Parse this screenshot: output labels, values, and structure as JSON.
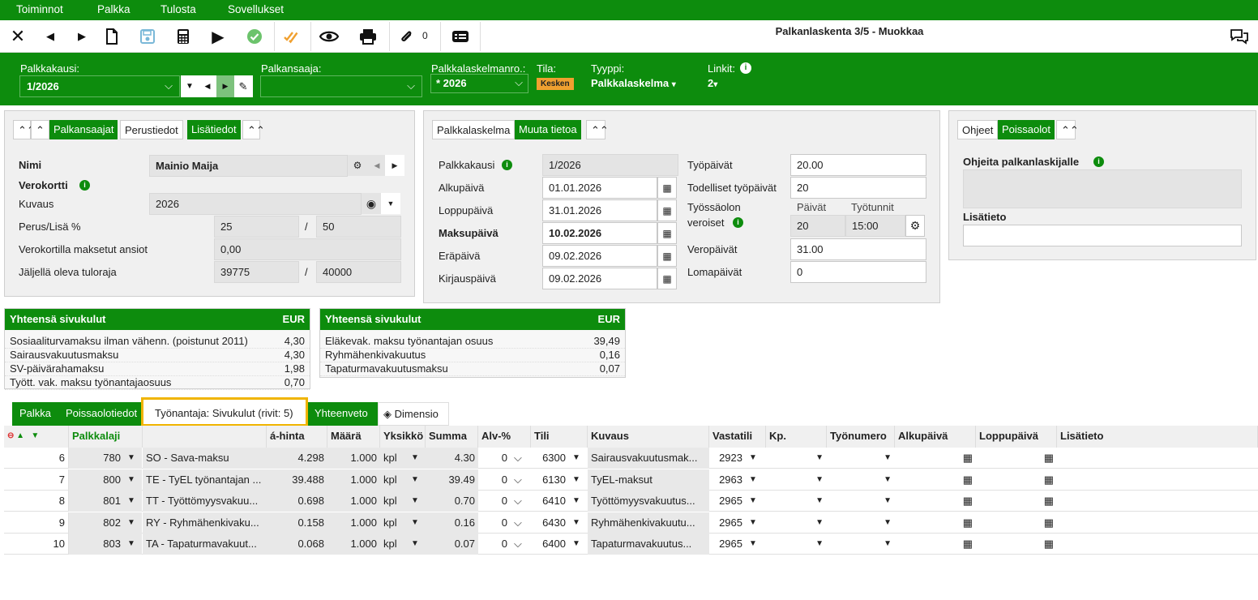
{
  "menu": {
    "items": [
      "Toiminnot",
      "Palkka",
      "Tulosta",
      "Sovellukset"
    ]
  },
  "toolbar": {
    "attach_count": "0",
    "title": "Palkanlaskenta 3/5 - Muokkaa"
  },
  "header": {
    "period_label": "Palkkakausi:",
    "period_value": "1/2026",
    "earner_label": "Palkansaaja:",
    "earner_value": "",
    "calcno_label": "Palkkalaskelmanro.:",
    "calcno_value": "* 2026",
    "state_label": "Tila:",
    "state_value": "Kesken",
    "type_label": "Tyyppi:",
    "type_value": "Palkkalaskelma",
    "links_label": "Linkit:",
    "links_value": "2"
  },
  "left": {
    "tabs": [
      "Palkansaajat",
      "Perustiedot",
      "Lisätiedot"
    ],
    "name_label": "Nimi",
    "name_value": "Mainio Maija",
    "taxcard_label": "Verokortti",
    "desc_label": "Kuvaus",
    "desc_value": "2026",
    "pct_label": "Perus/Lisä %",
    "pct_base": "25",
    "pct_extra": "50",
    "paid_label": "Verokortilla maksetut ansiot",
    "paid_value": "0,00",
    "limit_label": "Jäljellä oleva tuloraja",
    "limit_left": "39775",
    "limit_total": "40000",
    "slash": "/"
  },
  "mid": {
    "tabs": [
      "Palkkalaskelma",
      "Muuta tietoa"
    ],
    "period_label": "Palkkakausi",
    "period_value": "1/2026",
    "start_label": "Alkupäivä",
    "start_value": "01.01.2026",
    "end_label": "Loppupäivä",
    "end_value": "31.01.2026",
    "pay_label": "Maksupäivä",
    "pay_value": "10.02.2026",
    "due_label": "Eräpäivä",
    "due_value": "09.02.2026",
    "book_label": "Kirjauspäivä",
    "book_value": "09.02.2026",
    "workdays_label": "Työpäivät",
    "workdays_value": "20.00",
    "actual_label": "Todelliset työpäivät",
    "actual_value": "20",
    "emp_label1": "Työssäolon",
    "emp_label2": "veroiset",
    "days_head": "Päivät",
    "hours_head": "Työtunnit",
    "emp_days": "20",
    "emp_hours": "15:00",
    "taxdays_label": "Veropäivät",
    "taxdays_value": "31.00",
    "holiday_label": "Lomapäivät",
    "holiday_value": "0"
  },
  "right": {
    "tabs": [
      "Ohjeet",
      "Poissaolot"
    ],
    "guide_label": "Ohjeita palkanlaskijalle",
    "extra_label": "Lisätieto"
  },
  "sum1": {
    "title": "Yhteensä sivukulut",
    "cur": "EUR",
    "rows": [
      {
        "k": "Sosiaaliturvamaksu ilman vähenn. (poistunut 2011)",
        "v": "4,30"
      },
      {
        "k": "Sairausvakuutusmaksu",
        "v": "4,30"
      },
      {
        "k": "SV-päivärahamaksu",
        "v": "1,98"
      },
      {
        "k": "Tyött. vak. maksu työnantajaosuus",
        "v": "0,70"
      }
    ]
  },
  "sum2": {
    "title": "Yhteensä sivukulut",
    "cur": "EUR",
    "rows": [
      {
        "k": "Eläkevak. maksu työnantajan osuus",
        "v": "39,49"
      },
      {
        "k": "Ryhmähenkivakuutus",
        "v": "0,16"
      },
      {
        "k": "Tapaturmavakuutusmaksu",
        "v": "0,07"
      }
    ]
  },
  "gridtabs": [
    "Palkka",
    "Poissaolotiedot",
    "Työnantaja: Sivukulut (rivit: 5)",
    "Yhteenveto",
    "Dimensio"
  ],
  "columns": [
    "Palkkalaji",
    "á-hinta",
    "Määrä",
    "Yksikkö",
    "Summa",
    "Alv-%",
    "Tili",
    "Kuvaus",
    "Vastatili",
    "Kp.",
    "Työnumero",
    "Alkupäivä",
    "Loppupäivä",
    "Lisätieto"
  ],
  "rows": [
    {
      "n": "6",
      "code": "780",
      "type": "SO - Sava-maksu",
      "price": "4.298",
      "qty": "1.000",
      "unit": "kpl",
      "sum": "4.30",
      "vat": "0",
      "acc": "6300",
      "desc": "Sairausvakuutusmak...",
      "cacc": "2923"
    },
    {
      "n": "7",
      "code": "800",
      "type": "TE - TyEL työnantajan ...",
      "price": "39.488",
      "qty": "1.000",
      "unit": "kpl",
      "sum": "39.49",
      "vat": "0",
      "acc": "6130",
      "desc": "TyEL-maksut",
      "cacc": "2963"
    },
    {
      "n": "8",
      "code": "801",
      "type": "TT - Työttömyysvakuu...",
      "price": "0.698",
      "qty": "1.000",
      "unit": "kpl",
      "sum": "0.70",
      "vat": "0",
      "acc": "6410",
      "desc": "Työttömyysvakuutus...",
      "cacc": "2965"
    },
    {
      "n": "9",
      "code": "802",
      "type": "RY - Ryhmähenkivaku...",
      "price": "0.158",
      "qty": "1.000",
      "unit": "kpl",
      "sum": "0.16",
      "vat": "0",
      "acc": "6430",
      "desc": "Ryhmähenkivakuutu...",
      "cacc": "2965"
    },
    {
      "n": "10",
      "code": "803",
      "type": "TA - Tapaturmavakuut...",
      "price": "0.068",
      "qty": "1.000",
      "unit": "kpl",
      "sum": "0.07",
      "vat": "0",
      "acc": "6400",
      "desc": "Tapaturmavakuutus...",
      "cacc": "2965"
    }
  ],
  "colors": {
    "green": "#0d8c0d",
    "highlight": "#f0b400",
    "badge": "#f0a030"
  }
}
